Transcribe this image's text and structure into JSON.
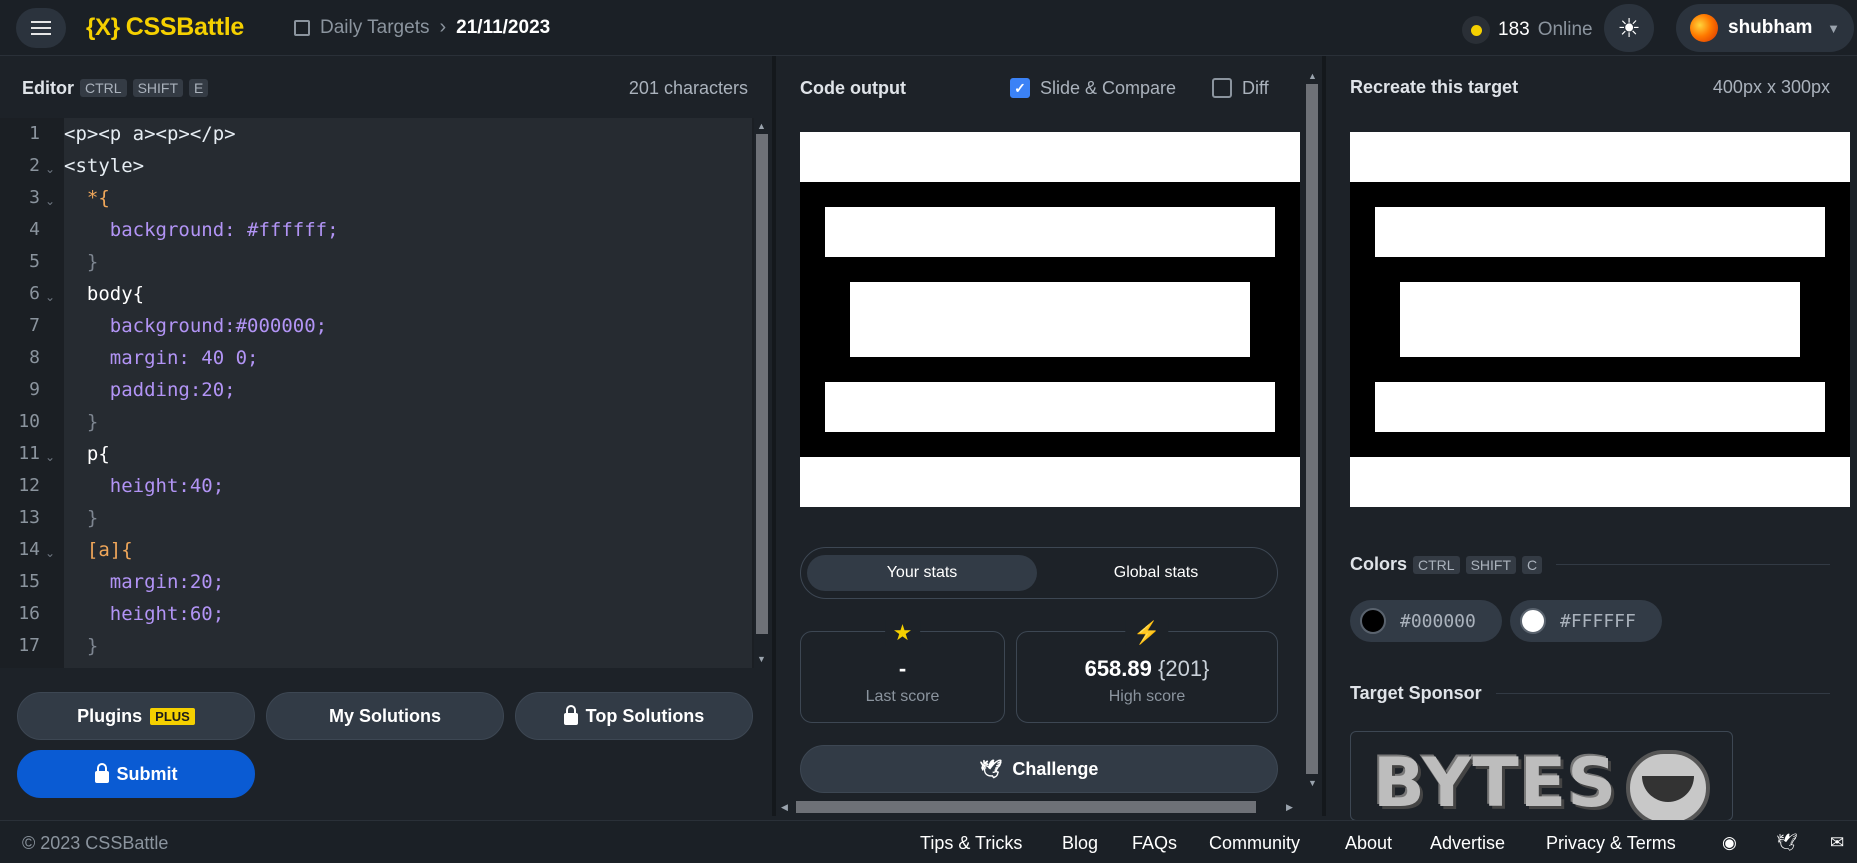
{
  "header": {
    "logo_mark": "{X}",
    "logo_text": "CSSBattle",
    "breadcrumb_section": "Daily Targets",
    "breadcrumb_date": "21/11/2023",
    "online_count": "183",
    "online_label": "Online",
    "username": "shubham"
  },
  "editor": {
    "title": "Editor",
    "shortcut": [
      "CTRL",
      "SHIFT",
      "E"
    ],
    "char_count": "201 characters",
    "line_numbers": [
      "1",
      "2",
      "3",
      "4",
      "5",
      "6",
      "7",
      "8",
      "9",
      "10",
      "11",
      "12",
      "13",
      "14",
      "15",
      "16",
      "17"
    ],
    "lines": [
      "<p><p a><p></p>",
      "<style>",
      "  *{",
      "    background: #ffffff;",
      "  }",
      "  body{",
      "    background:#000000;",
      "    margin: 40 0;",
      "    padding:20;",
      "  }",
      "  p{",
      "    height:40;",
      "  }",
      "  [a]{",
      "    margin:20;",
      "    height:60;",
      "  }"
    ]
  },
  "actions": {
    "plugins": "Plugins",
    "plus_badge": "PLUS",
    "my_solutions": "My Solutions",
    "top_solutions": "Top Solutions",
    "submit": "Submit"
  },
  "output": {
    "title": "Code output",
    "slide_compare": "Slide & Compare",
    "slide_compare_checked": true,
    "diff": "Diff",
    "diff_checked": false
  },
  "stats": {
    "tab_your": "Your stats",
    "tab_global": "Global stats",
    "last_score_value": "-",
    "last_score_label": "Last score",
    "high_score_value": "658.89",
    "high_score_chars": "{201}",
    "high_score_label": "High score",
    "challenge": "Challenge"
  },
  "target": {
    "title": "Recreate this target",
    "size": "400px x 300px",
    "colors_title": "Colors",
    "colors_shortcut": [
      "CTRL",
      "SHIFT",
      "C"
    ],
    "colors": [
      "#000000",
      "#FFFFFF"
    ],
    "sponsor_title": "Target Sponsor",
    "sponsor_logo_text": "BYTES"
  },
  "footer": {
    "copyright": "© 2023 CSSBattle",
    "links": [
      "Tips & Tricks",
      "Blog",
      "FAQs",
      "Community",
      "About",
      "Advertise",
      "Privacy & Terms"
    ]
  },
  "colors": {
    "accent_yellow": "#f5d000",
    "submit_blue": "#0a5bd3",
    "checkbox_blue": "#3b82f6"
  }
}
